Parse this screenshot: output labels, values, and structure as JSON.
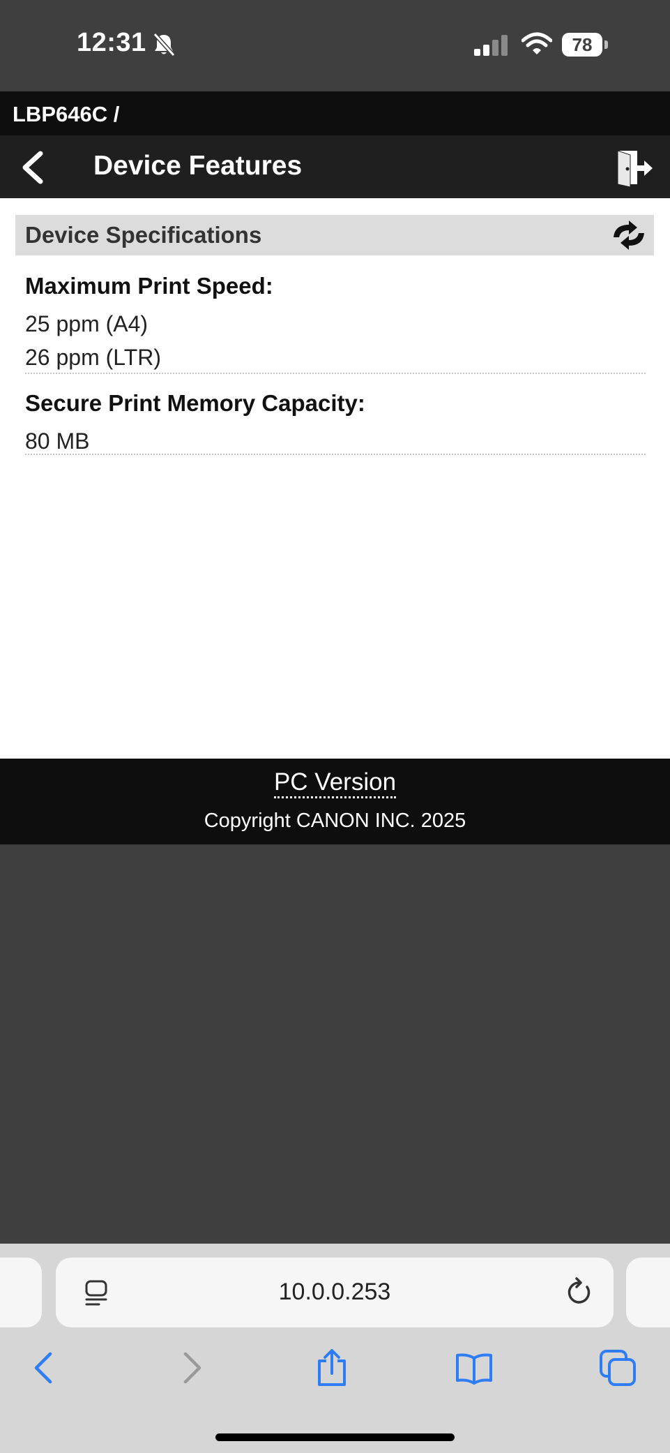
{
  "status_bar": {
    "time": "12:31",
    "battery": "78"
  },
  "breadcrumb": "LBP646C /",
  "header": {
    "title": "Device Features"
  },
  "section": {
    "title": "Device Specifications",
    "items": [
      {
        "label": "Maximum Print Speed:",
        "values": [
          "25 ppm (A4)",
          "26 ppm (LTR)"
        ]
      },
      {
        "label": "Secure Print Memory Capacity:",
        "values": [
          "80 MB"
        ]
      }
    ]
  },
  "footer": {
    "pc_version": "PC Version",
    "copyright": "Copyright CANON INC. 2025"
  },
  "browser": {
    "url": "10.0.0.253"
  },
  "icons": {
    "bell": "bell-slash-icon",
    "signal": "signal-icon",
    "wifi": "wifi-icon",
    "back": "chevron-left-icon",
    "logout": "logout-door-icon",
    "refresh": "refresh-arrows-icon",
    "page_menu": "page-menu-icon",
    "reload": "reload-icon",
    "nav_back": "nav-back-icon",
    "nav_forward": "nav-forward-icon",
    "share": "share-icon",
    "bookmarks": "bookmarks-icon",
    "tabs": "tabs-icon"
  },
  "colors": {
    "accent_blue": "#2f7df6",
    "disabled_gray": "#9a9a9a",
    "header_dark": "#1f1f1f"
  }
}
